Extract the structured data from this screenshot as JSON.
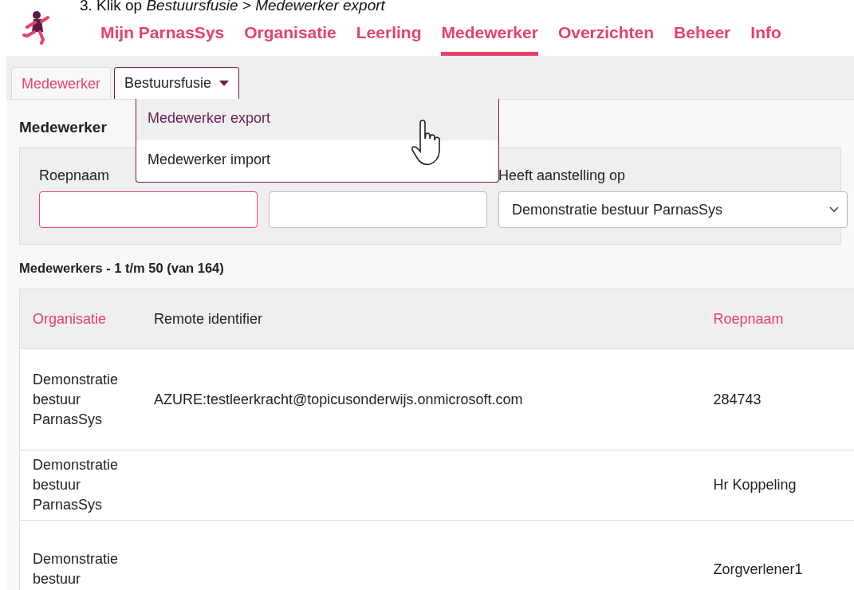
{
  "instruction": "3. Klik op *Bestuursfusie > Medewerker export*",
  "nav": [
    {
      "label": "Mijn ParnasSys",
      "selected": false
    },
    {
      "label": "Organisatie",
      "selected": false
    },
    {
      "label": "Leerling",
      "selected": false
    },
    {
      "label": "Medewerker",
      "selected": true
    },
    {
      "label": "Overzichten",
      "selected": false
    },
    {
      "label": "Beheer",
      "selected": false
    },
    {
      "label": "Info",
      "selected": false
    }
  ],
  "tabs": [
    {
      "label": "Medewerker",
      "selected": true,
      "kind": "tab"
    },
    {
      "label": "Bestuursfusie",
      "selected": false,
      "kind": "menu",
      "expanded": true
    }
  ],
  "menu": [
    {
      "label": "Medewerker export",
      "highlighted": true
    },
    {
      "label": "Medewerker import",
      "highlighted": false
    }
  ],
  "heading": "Medewerker",
  "filters": [
    {
      "label": "Roepnaam",
      "kind": "text",
      "focused": true
    },
    {
      "kind": "text",
      "focused": false
    },
    {
      "label": "Heeft aanstelling op",
      "kind": "select",
      "value": "Demonstratie bestuur ParnasSys",
      "focused": false
    }
  ],
  "results_title": "Medewerkers - 1 t/m 50 (van 164)",
  "table": {
    "columns": [
      {
        "label": "Organisatie",
        "sortable": true
      },
      {
        "label": "Remote identifier",
        "sortable": false
      },
      {
        "label": "Roepnaam",
        "sortable": true
      }
    ],
    "rows": [
      [
        "Demonstratie bestuur ParnasSys",
        "AZURE:testleerkracht@topicusonderwijs.onmicrosoft.com",
        "284743"
      ],
      [
        "Demonstratie bestuur ParnasSys",
        "",
        "Hr Koppeling"
      ],
      [
        "Demonstratie bestuur",
        "",
        "Zorgverlener1"
      ]
    ]
  }
}
